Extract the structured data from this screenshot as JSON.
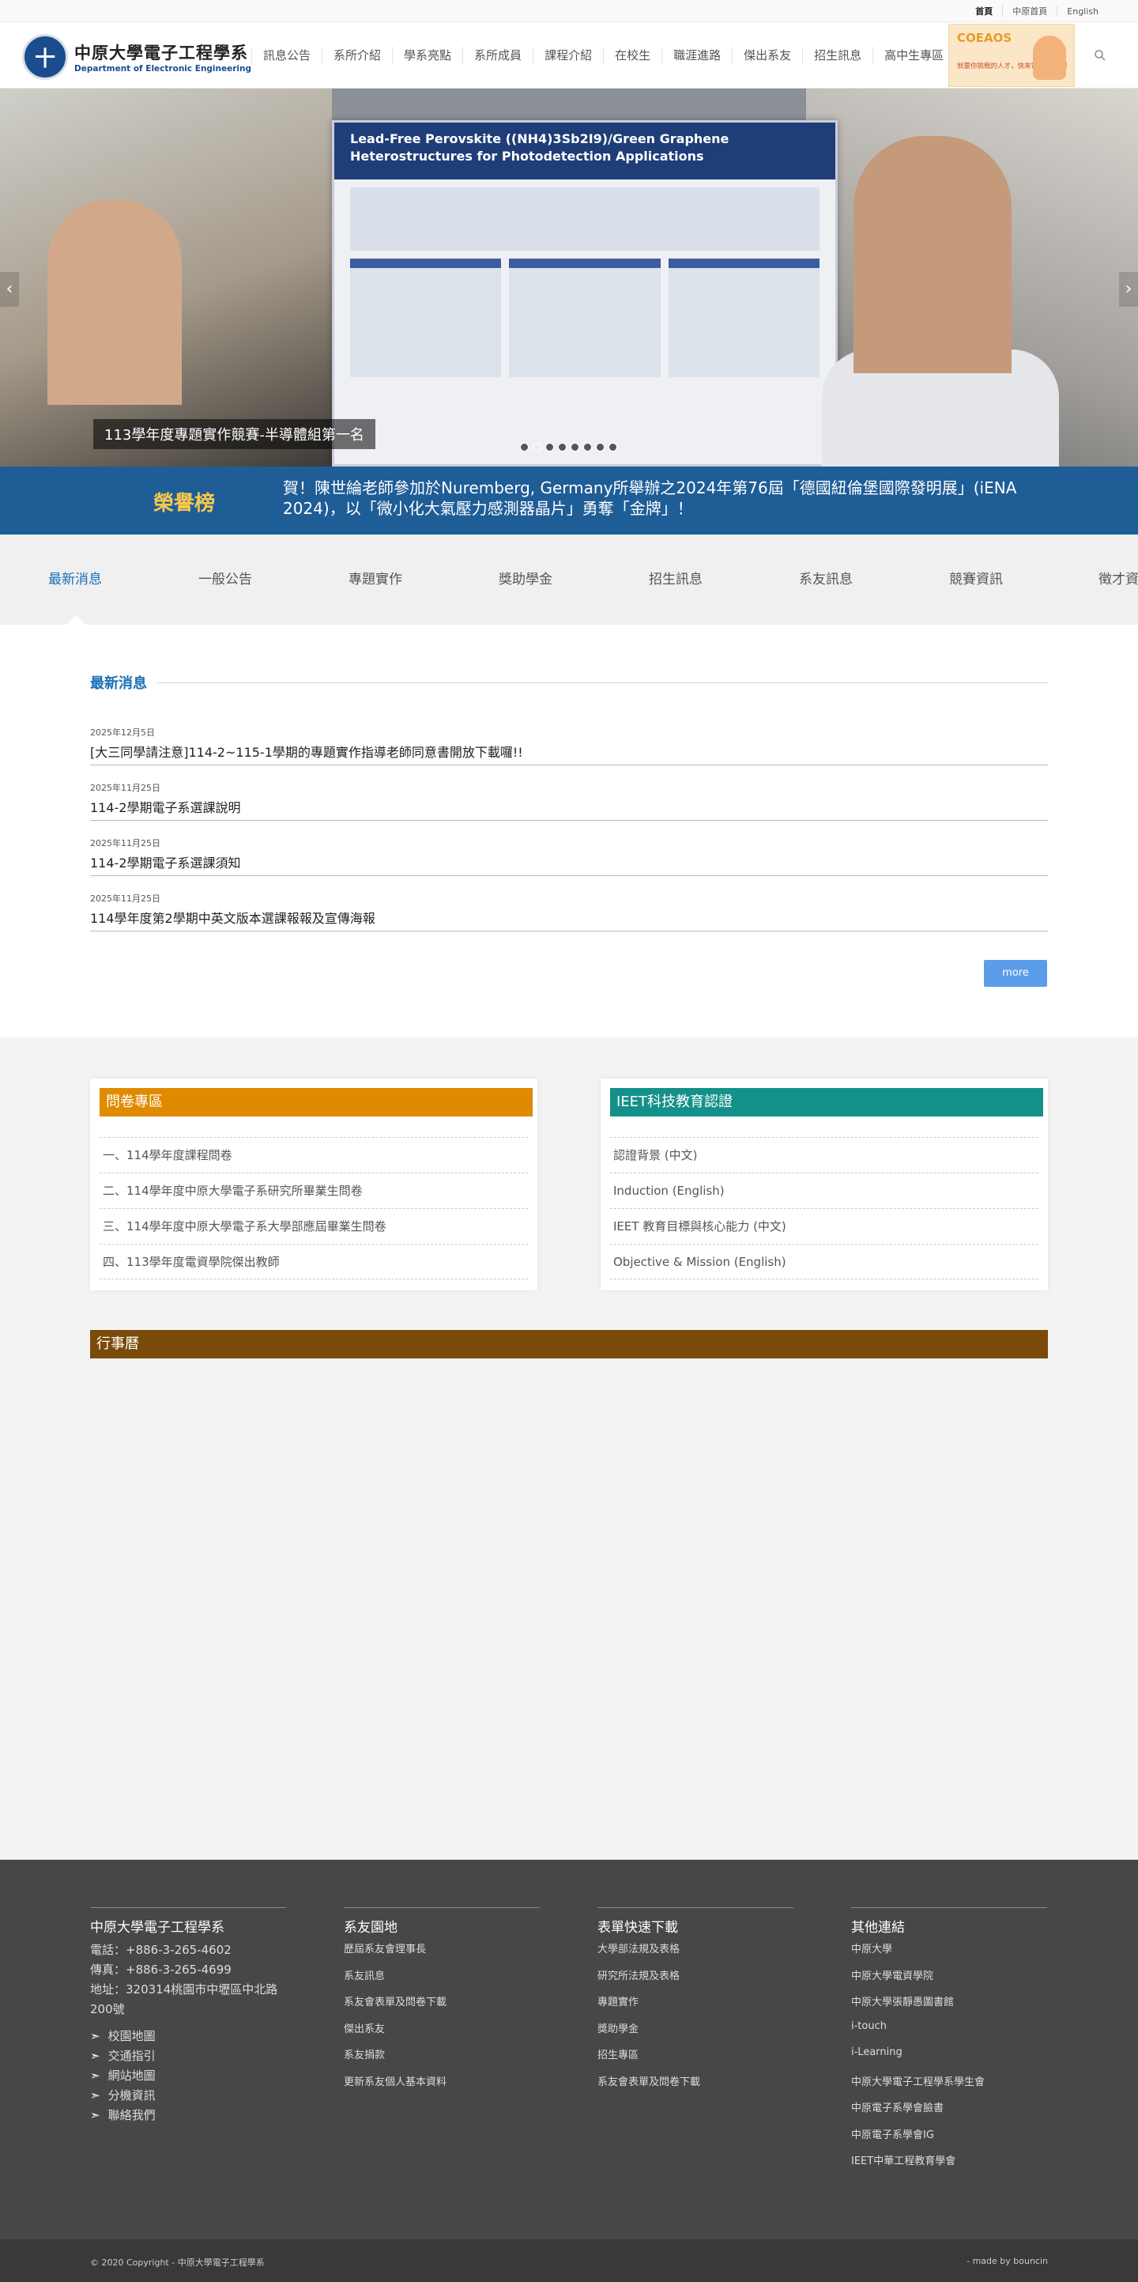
{
  "topbar": {
    "links": [
      "首頁",
      "中原首頁",
      "English"
    ]
  },
  "header": {
    "logo_cn": "中原大學電子工程學系",
    "logo_en": "Department of Electronic Engineering",
    "nav": [
      "訊息公告",
      "系所介紹",
      "學系亮點",
      "系所成員",
      "課程介紹",
      "在校生",
      "職涯進路",
      "傑出系友",
      "招生訊息",
      "高中生專區"
    ],
    "ad_title": "COEAOS",
    "ad_text": "就要你挑戰的人才，快來電資學院吧！"
  },
  "hero": {
    "caption": "113學年度專題實作競賽-半導體組第一名",
    "poster_title": "Lead-Free Perovskite ((NH4)3Sb2I9)/Green Graphene Heterostructures for Photodetection Applications",
    "slide_count": 8,
    "active_slide": 1
  },
  "honor": {
    "label": "榮譽榜",
    "text": "賀！陳世綸老師參加於Nuremberg, Germany所舉辦之2024年第76屆「德國紐倫堡國際發明展」(iENA 2024)，以「微小化大氣壓力感測器晶片」勇奪「金牌」！"
  },
  "tabs": [
    "最新消息",
    "一般公告",
    "專題實作",
    "獎助學金",
    "招生訊息",
    "系友訊息",
    "競賽資訊",
    "徵才資訊"
  ],
  "news": {
    "title": "最新消息",
    "items": [
      {
        "date": "2025年12月5日",
        "title": "[大三同學請注意]114-2~115-1學期的專題實作指導老師同意書開放下載囉!!"
      },
      {
        "date": "2025年11月25日",
        "title": "114-2學期電子系選課說明"
      },
      {
        "date": "2025年11月25日",
        "title": "114-2學期電子系選課須知"
      },
      {
        "date": "2025年11月25日",
        "title": "114學年度第2學期中英文版本選課報報及宣傳海報"
      }
    ],
    "more": "more"
  },
  "survey": {
    "title": "問卷專區",
    "color": "#e08a00",
    "items": [
      "一、114學年度課程問卷",
      "二、114學年度中原大學電子系研究所畢業生問卷",
      "三、114學年度中原大學電子系大學部應屆畢業生問卷",
      "四、113學年度電資學院傑出教師"
    ]
  },
  "ieet": {
    "title": "IEET科技教育認證",
    "color": "#14908a",
    "items": [
      "認證背景 (中文)",
      "Induction (English)",
      "IEET 教育目標與核心能力 (中文)",
      "Objective & Mission (English)"
    ]
  },
  "calendar": {
    "title": "行事曆"
  },
  "footer": {
    "col1": {
      "title": "中原大學電子工程學系",
      "phone": "電話：+886-3-265-4602",
      "fax": "傳真：+886-3-265-4699",
      "address": "地址：320314桃園市中壢區中北路200號",
      "links": [
        "校園地圖",
        "交通指引",
        "網站地圖",
        "分機資訊",
        "聯絡我們"
      ]
    },
    "col2": {
      "title": "系友園地",
      "links": [
        "歷屆系友會理事長",
        "系友訊息",
        "系友會表單及問卷下載",
        "傑出系友",
        "系友捐款",
        "更新系友個人基本資料"
      ]
    },
    "col3": {
      "title": "表單快速下載",
      "links": [
        "大學部法規及表格",
        "研究所法規及表格",
        "專題實作",
        "獎助學金",
        "招生專區",
        "系友會表單及問卷下載"
      ]
    },
    "col4": {
      "title": "其他連結",
      "links": [
        "中原大學",
        "中原大學電資學院",
        "中原大學張靜愚圖書館",
        "i-touch",
        "i-Learning",
        "中原大學電子工程學系學生會",
        "中原電子系學會臉書",
        "中原電子系學會IG",
        "IEET中華工程教育學會"
      ]
    }
  },
  "bottom": {
    "copyright": "© 2020 Copyright - 中原大學電子工程學系",
    "made_by": "- made by bouncin"
  }
}
